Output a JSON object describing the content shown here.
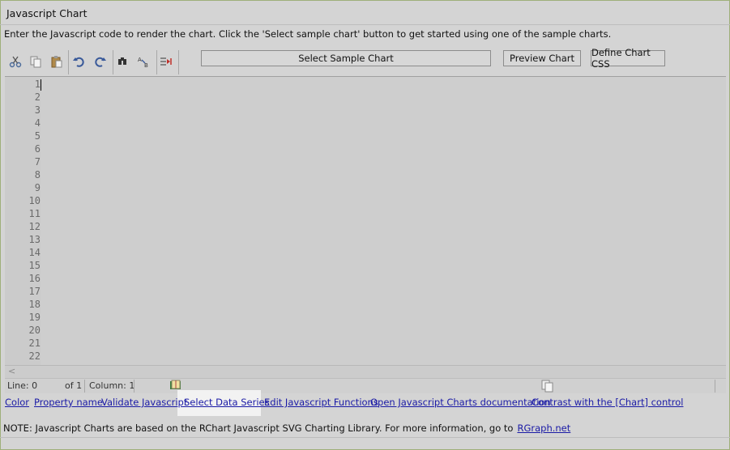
{
  "window": {
    "title": "Javascript Chart"
  },
  "instructions": "Enter the Javascript code to render the chart. Click the 'Select sample chart' button to get started using one of the sample charts.",
  "toolbar": {
    "icons": [
      "scissors-icon",
      "copy-icon",
      "paste-icon",
      "undo-icon",
      "redo-icon",
      "find-icon",
      "replace-icon",
      "indent-icon"
    ],
    "select_sample_label": "Select Sample Chart",
    "preview_label": "Preview Chart",
    "define_css_label": "Define Chart CSS"
  },
  "editor": {
    "line_numbers": [
      "1",
      "2",
      "3",
      "4",
      "5",
      "6",
      "7",
      "8",
      "9",
      "10",
      "11",
      "12",
      "13",
      "14",
      "15",
      "16",
      "17",
      "18",
      "19",
      "20",
      "21",
      "22"
    ],
    "content": ""
  },
  "status": {
    "line": "Line: 0",
    "of": "of 1",
    "column": "Column: 1"
  },
  "links": [
    "Color",
    "Property name",
    "Validate Javascript",
    "Select Data Series",
    "Edit Javascript Functions",
    "Open Javascript Charts documentation",
    "Contrast with the [Chart] control"
  ],
  "note": {
    "text": "NOTE: Javascript Charts are based on the RChart Javascript SVG Charting Library. For more information, go to",
    "link": "RGraph.net"
  },
  "colors": {
    "link": "#1a1aa6",
    "background": "#d4d4d4",
    "editor": "#cecece"
  }
}
